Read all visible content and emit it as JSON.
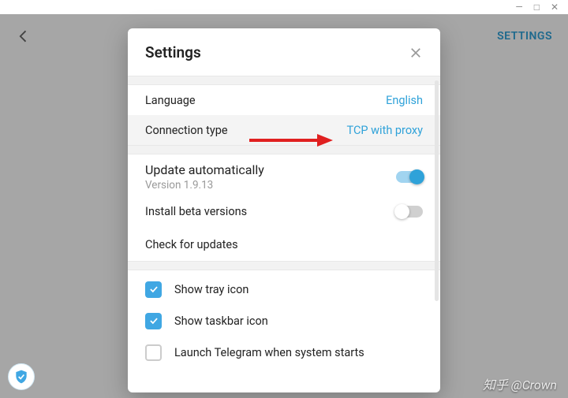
{
  "window_controls": {
    "minimize": "—",
    "maximize": "□",
    "close": "✕"
  },
  "header": {
    "settings_link": "SETTINGS"
  },
  "modal": {
    "title": "Settings",
    "rows": {
      "language": {
        "label": "Language",
        "value": "English"
      },
      "connection": {
        "label": "Connection type",
        "value": "TCP with proxy"
      },
      "update_auto": {
        "label": "Update automatically",
        "sublabel": "Version 1.9.13",
        "toggle": true
      },
      "beta": {
        "label": "Install beta versions",
        "toggle": false
      },
      "check_updates": {
        "label": "Check for updates"
      }
    },
    "checks": {
      "tray": {
        "label": "Show tray icon",
        "checked": true
      },
      "taskbar": {
        "label": "Show taskbar icon",
        "checked": true
      },
      "autostart": {
        "label": "Launch Telegram when system starts",
        "checked": false
      }
    }
  },
  "watermark": "知乎 @Crown"
}
